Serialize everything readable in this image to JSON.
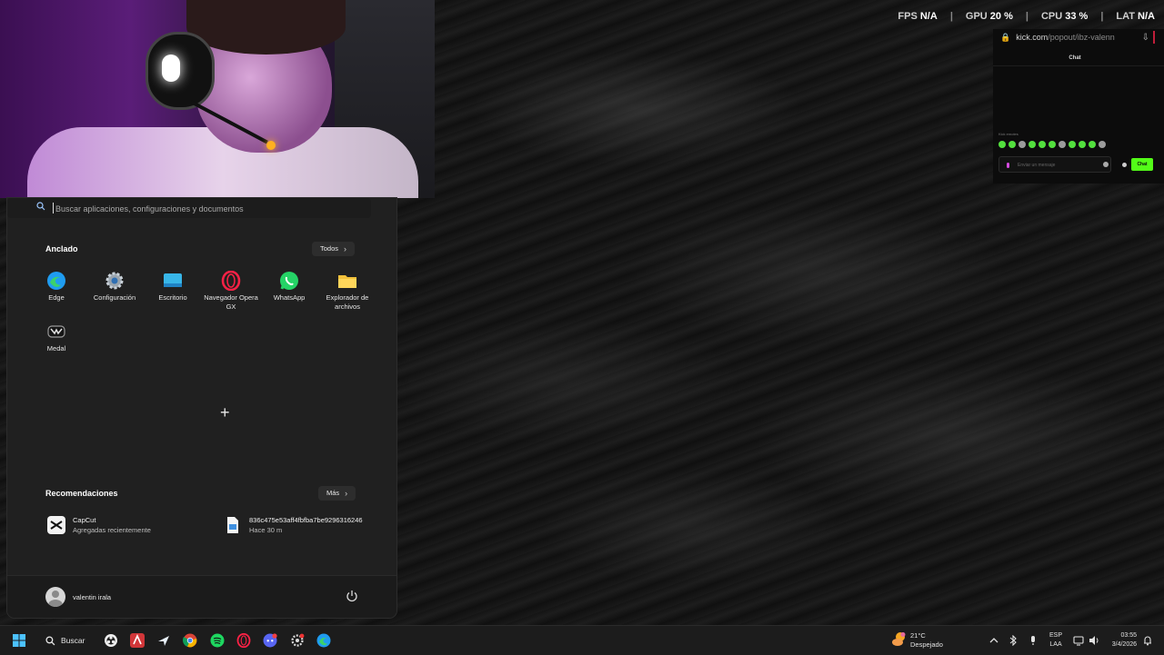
{
  "overlay": {
    "fps_label": "FPS",
    "fps_value": "N/A",
    "gpu_label": "GPU",
    "gpu_value": "20 %",
    "cpu_label": "CPU",
    "cpu_value": "33 %",
    "lat_label": "LAT",
    "lat_value": "N/A",
    "separator": "|"
  },
  "chat_popup": {
    "url_domain": "kick.com",
    "url_path": "/popout/ibz-valenn",
    "title": "Chat",
    "emotes_label": "Kick emotes",
    "input_placeholder": "Enviar un mensaje",
    "send_label": "Chat"
  },
  "start_menu": {
    "search_placeholder": "Buscar aplicaciones, configuraciones y documentos",
    "pinned_title": "Anclado",
    "all_button": "Todos",
    "pinned_apps": [
      {
        "label": "Edge",
        "icon": "edge-icon"
      },
      {
        "label": "Configuración",
        "icon": "settings-gear-icon"
      },
      {
        "label": "Escritorio",
        "icon": "desktop-icon"
      },
      {
        "label": "Navegador Opera GX",
        "icon": "opera-gx-icon"
      },
      {
        "label": "WhatsApp",
        "icon": "whatsapp-icon"
      },
      {
        "label": "Explorador de archivos",
        "icon": "folder-icon"
      },
      {
        "label": "Medal",
        "icon": "medal-icon"
      }
    ],
    "recommended_title": "Recomendaciones",
    "more_button": "Más",
    "recommendations": [
      {
        "title": "CapCut",
        "subtitle": "Agregadas recientemente",
        "icon": "capcut-icon"
      },
      {
        "title": "836c475e53aff4fbfba7be9296316246",
        "subtitle": "Hace 30 m",
        "icon": "file-icon"
      }
    ],
    "user_name": "valentin irala"
  },
  "taskbar": {
    "search_label": "Buscar",
    "apps": [
      "start-icon",
      "search-icon",
      "obs-icon",
      "riot-icon",
      "steam-icon",
      "chrome-icon",
      "spotify-icon",
      "opera-gx-icon",
      "discord-icon",
      "settings-icon",
      "edge-icon"
    ],
    "weather_temp": "21°C",
    "weather_desc": "Despejado",
    "lang_top": "ESP",
    "lang_bottom": "LAA",
    "time": "03:55",
    "date": "3/4/2026"
  },
  "colors": {
    "kick_green": "#53fc18",
    "menu_bg": "#202020",
    "taskbar_bg": "#1c1c1c"
  }
}
